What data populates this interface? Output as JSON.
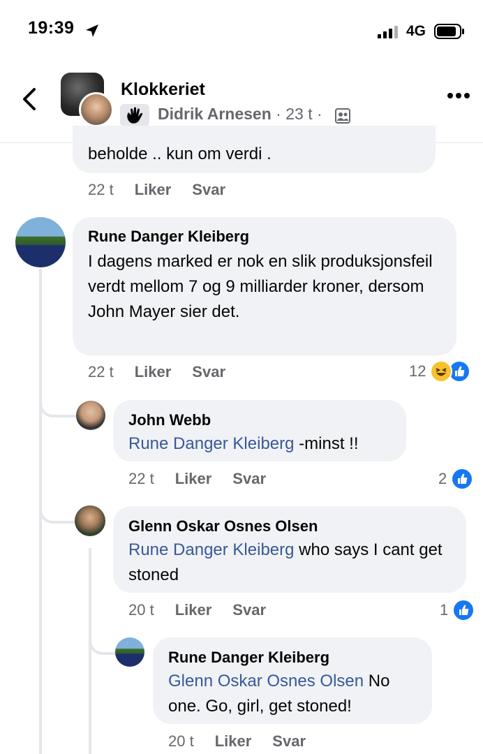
{
  "status_bar": {
    "time": "19:39",
    "network": "4G"
  },
  "header": {
    "group_name": "Klokkeriet",
    "author": "Didrik Arnesen",
    "separator": "·",
    "age": "23 t",
    "separator2": "·"
  },
  "comments": [
    {
      "text": "beholde .. kun om verdi .",
      "time": "22 t",
      "like": "Liker",
      "reply": "Svar"
    },
    {
      "name": "Rune Danger Kleiberg",
      "text": "I dagens marked er nok en slik produksjonsfeil verdt mellom 7 og 9 milliarder kroner, dersom John Mayer sier det.",
      "time": "22 t",
      "like": "Liker",
      "reply": "Svar",
      "reactions": "12"
    },
    {
      "name": "John Webb",
      "mention": "Rune Danger Kleiberg",
      "text": " -minst !!",
      "time": "22 t",
      "like": "Liker",
      "reply": "Svar",
      "reactions": "2"
    },
    {
      "name": "Glenn Oskar Osnes Olsen",
      "mention": "Rune Danger Kleiberg",
      "text": " who says I cant get stoned",
      "time": "20 t",
      "like": "Liker",
      "reply": "Svar",
      "reactions": "1"
    },
    {
      "name": "Rune Danger Kleiberg",
      "mention": "Glenn Oskar Osnes Olsen",
      "text": " No one. Go, girl, get stoned!",
      "time": "20 t",
      "like": "Liker",
      "reply": "Svar"
    }
  ]
}
